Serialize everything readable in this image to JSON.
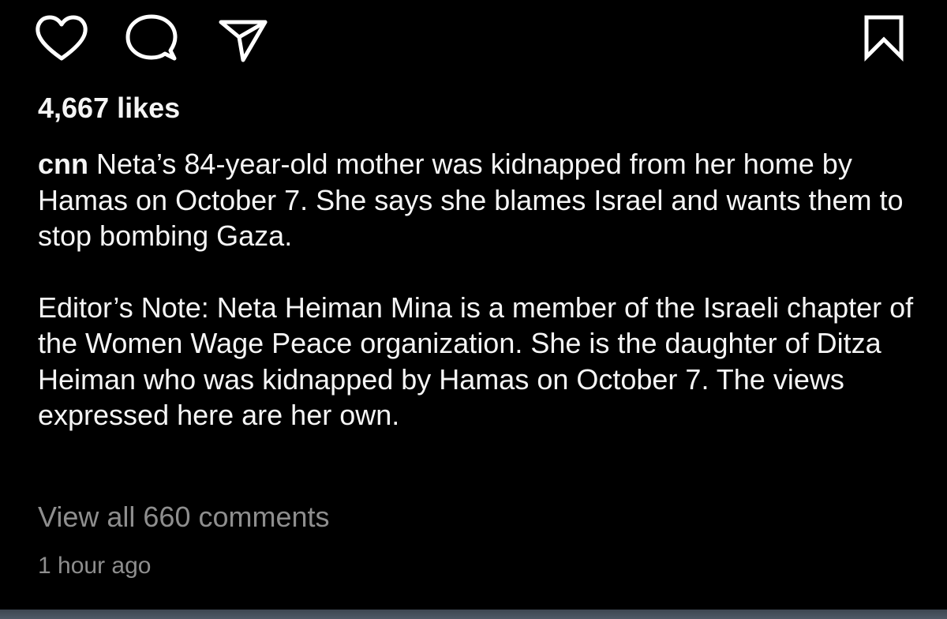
{
  "actions": {
    "like_icon": "heart-icon",
    "comment_icon": "comment-bubble-icon",
    "share_icon": "paper-plane-icon",
    "save_icon": "bookmark-icon"
  },
  "post": {
    "likes": "4,667 likes",
    "username": "cnn",
    "caption_paragraph_1": " Neta’s 84-year-old mother was kidnapped from her home by Hamas on October 7. She says she blames Israel and wants them to stop bombing Gaza.",
    "caption_paragraph_2": "Editor’s Note: Neta Heiman Mina is a member of the Israeli chapter of the Women Wage Peace organization. She is the daughter of Ditza Heiman who was kidnapped by Hamas on October 7. The views expressed here are her own.",
    "view_comments": "View all 660 comments",
    "timestamp": "1 hour ago"
  },
  "colors": {
    "background": "#000000",
    "text": "#f5f5f5",
    "muted_text": "#8e8e8e"
  }
}
